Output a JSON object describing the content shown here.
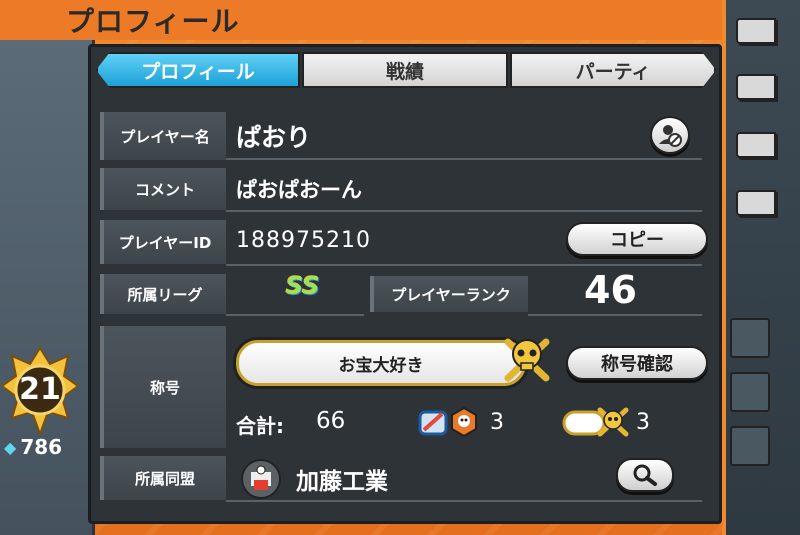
{
  "header": {
    "title": "プロフィール"
  },
  "tabs": [
    {
      "label": "プロフィール",
      "active": true
    },
    {
      "label": "戦績",
      "active": false
    },
    {
      "label": "パーティ",
      "active": false
    }
  ],
  "profile": {
    "player_name_label": "プレイヤー名",
    "player_name": "ぱおり",
    "comment_label": "コメント",
    "comment": "ぱおぱおーん",
    "player_id_label": "プレイヤーID",
    "player_id": "188975210",
    "copy_button": "コピー",
    "league_label": "所属リーグ",
    "league_badge": "SS",
    "rank_label": "プレイヤーランク",
    "rank_value": "46",
    "title_label": "称号",
    "title_value": "お宝大好き",
    "title_confirm_button": "称号確認",
    "total_label": "合計:",
    "total_value": "66",
    "count_a": "3",
    "count_b": "3",
    "alliance_label": "所属同盟",
    "alliance_name": "加藤工業"
  },
  "side": {
    "level": "21",
    "score": "786"
  },
  "colors": {
    "accent_orange": "#ec7a27",
    "tab_active": "#1ea0d8",
    "panel_bg": "#2e3338"
  },
  "icons": {
    "mute": "mute-user-icon",
    "search": "search-icon",
    "skull": "skull-crossbones-icon"
  }
}
